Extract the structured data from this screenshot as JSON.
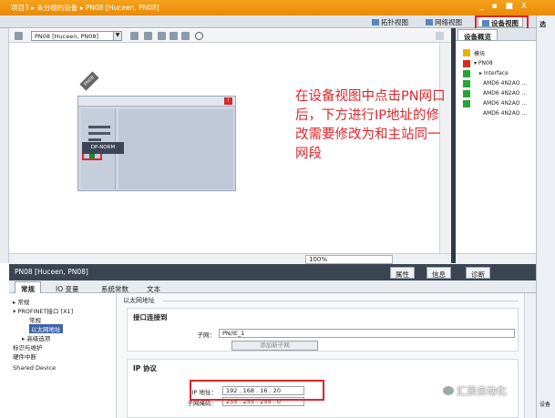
{
  "window": {
    "title": "项目3 ▸ 未分组的设备 ▸ PN08 [Huceen, PN08]",
    "controls": "_ ▪ ■ X",
    "right_strip_label": "选",
    "right_strip_bottom": "设备"
  },
  "view_tabs": [
    {
      "label": "拓扑视图"
    },
    {
      "label": "网络视图"
    },
    {
      "label": "设备视图",
      "active": true
    }
  ],
  "editor_toolbar": {
    "device_select": "PN08 [Huceen, PN08]"
  },
  "canvas": {
    "device_tag": "PN08",
    "module_label": "DP-NORM",
    "zoom": "100%",
    "annotation": "在设备视图中点击PN网口后，下方进行IP地址的修改需要修改为和主站同一网段"
  },
  "device_overview": {
    "tab_label": "设备概览",
    "rows": [
      {
        "label": "模块",
        "status": "ok"
      },
      {
        "label": "▾ PN08",
        "status": "error"
      },
      {
        "label": "▸ Interface",
        "status": "ok"
      },
      {
        "label": "AMD6 4N2AO ...",
        "status": "ok"
      },
      {
        "label": "AMD6 4N2AO ...",
        "status": "ok"
      },
      {
        "label": "AMD6 4N2AO ...",
        "status": "ok"
      },
      {
        "label": "AMD6 4N2AO ...",
        "status": "ok"
      }
    ]
  },
  "properties": {
    "title": "PN08 [Huceen, PN08]",
    "tabs": [
      {
        "label": "属性"
      },
      {
        "label": "信息"
      },
      {
        "label": "诊断"
      }
    ],
    "sub_tabs": [
      {
        "label": "常规",
        "active": true
      },
      {
        "label": "IO 变量"
      },
      {
        "label": "系统常数"
      },
      {
        "label": "文本"
      }
    ],
    "nav": [
      {
        "label": "▸ 常规"
      },
      {
        "label": "▾ PROFINET接口 [X1]"
      },
      {
        "label": "常规"
      },
      {
        "label": "以太网地址",
        "selected": true
      },
      {
        "label": "▸ 高级选项"
      },
      {
        "label": "标识与维护"
      },
      {
        "label": "硬件中断"
      },
      {
        "label": "Shared Device"
      }
    ],
    "section_label": "以太网地址",
    "interface_group": {
      "title": "接口连接到",
      "subnet_label": "子网：",
      "subnet_value": "PN/IE_1",
      "add_button": "添加新子网"
    },
    "ip_group": {
      "title": "IP 协议",
      "ip_label": "IP 地址：",
      "ip_value": "192 . 168 . 16 . 20",
      "mask_label": "子网掩码：",
      "mask_value": "255 . 255 . 255 . 0"
    }
  },
  "watermark": "汇辰自动化"
}
